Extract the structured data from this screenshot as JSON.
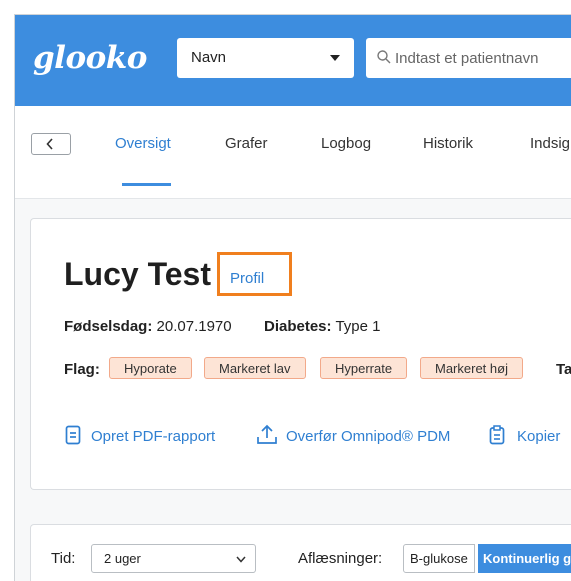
{
  "header": {
    "logo": "glooko",
    "select_label": "Navn",
    "search_placeholder": "Indtast et patientnavn"
  },
  "tabs": [
    {
      "label": "Oversigt"
    },
    {
      "label": "Grafer"
    },
    {
      "label": "Logbog"
    },
    {
      "label": "Historik"
    },
    {
      "label": "Indsig"
    }
  ],
  "patient": {
    "name": "Lucy Test",
    "profile_link": "Profil",
    "birthday_label": "Fødselsdag:",
    "birthday": "20.07.1970",
    "diabetes_label": "Diabetes:",
    "diabetes": "Type 1",
    "flags_label": "Flag:",
    "flags": [
      "Hyporate",
      "Markeret lav",
      "Hyperrate",
      "Markeret høj"
    ],
    "flags_overflow": "Ta",
    "actions": [
      "Opret PDF-rapport",
      "Overfør Omnipod® PDM",
      "Kopier"
    ]
  },
  "filters": {
    "time_label": "Tid:",
    "time_value": "2 uger",
    "readings_label": "Aflæsninger:",
    "readings_options": [
      "B-glukose",
      "Kontinuerlig g"
    ]
  },
  "colors": {
    "brand": "#3d8ddf",
    "link": "#2f7fd1",
    "highlight": "#f07f1e",
    "flag_bg": "#fde4d6"
  }
}
